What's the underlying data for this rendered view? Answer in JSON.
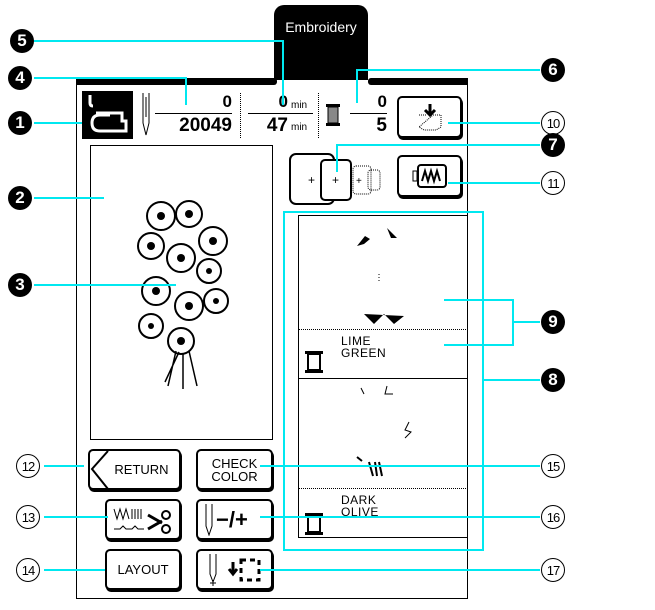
{
  "tab": {
    "label": "Embroidery"
  },
  "header": {
    "stitch_current": "0",
    "stitch_total": "20049",
    "time_current": "0",
    "time_total": "47",
    "time_unit": "min",
    "color_current": "0",
    "color_total": "5"
  },
  "color_list": [
    {
      "name_line1": "LIME",
      "name_line2": "GREEN"
    },
    {
      "name_line1": "DARK",
      "name_line2": "OLIVE"
    }
  ],
  "buttons": {
    "return": "RETURN",
    "check_color_line1": "CHECK",
    "check_color_line2": "COLOR",
    "layout": "LAYOUT",
    "needle_plus_minus": "−/+"
  },
  "callouts": {
    "n1": "1",
    "n2": "2",
    "n3": "3",
    "n4": "4",
    "n5": "5",
    "n6": "6",
    "n7": "7",
    "n8": "8",
    "n9": "9",
    "n10": "10",
    "n11": "11",
    "n12": "12",
    "n13": "13",
    "n14": "14",
    "n15": "15",
    "n16": "16",
    "n17": "17"
  },
  "colors": {
    "callout_line": "#00e8f0",
    "screen": "#000000"
  }
}
